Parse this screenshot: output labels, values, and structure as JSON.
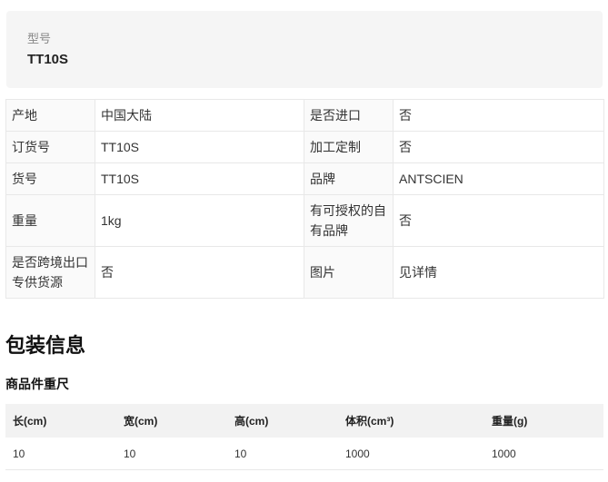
{
  "model": {
    "label": "型号",
    "value": "TT10S"
  },
  "attributes": [
    [
      {
        "k": "产地",
        "v": "中国大陆"
      },
      {
        "k": "是否进口",
        "v": "否"
      }
    ],
    [
      {
        "k": "订货号",
        "v": "TT10S"
      },
      {
        "k": "加工定制",
        "v": "否"
      }
    ],
    [
      {
        "k": "货号",
        "v": "TT10S"
      },
      {
        "k": "品牌",
        "v": "ANTSCIEN"
      }
    ],
    [
      {
        "k": "重量",
        "v": "1kg"
      },
      {
        "k": "有可授权的自有品牌",
        "v": "否"
      }
    ],
    [
      {
        "k": "是否跨境出口专供货源",
        "v": "否"
      },
      {
        "k": "图片",
        "v": "见详情"
      }
    ]
  ],
  "packaging": {
    "title": "包装信息",
    "subtitle": "商品件重尺",
    "headers": [
      "长(cm)",
      "宽(cm)",
      "高(cm)",
      "体积(cm³)",
      "重量(g)"
    ],
    "rows": [
      [
        "10",
        "10",
        "10",
        "1000",
        "1000"
      ]
    ]
  }
}
